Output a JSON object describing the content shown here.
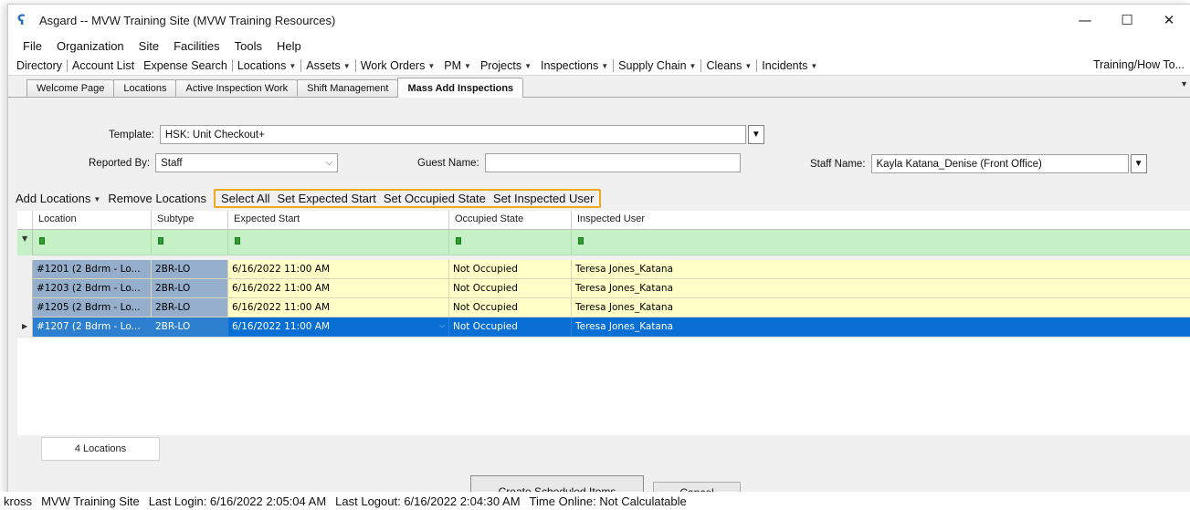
{
  "window": {
    "title": "Asgard -- MVW Training Site (MVW Training Resources)",
    "icon": "asgard-logo-icon",
    "controls": {
      "minimize": "—",
      "maximize": "☐",
      "close": "✕"
    }
  },
  "menu": [
    "File",
    "Organization",
    "Site",
    "Facilities",
    "Tools",
    "Help"
  ],
  "nav": {
    "items": [
      {
        "label": "Directory",
        "dropdown": false
      },
      {
        "label": "Account List",
        "dropdown": false
      },
      {
        "label": "Expense Search",
        "dropdown": false
      },
      {
        "label": "Locations",
        "dropdown": true
      },
      {
        "label": "Assets",
        "dropdown": true
      },
      {
        "label": "Work Orders",
        "dropdown": true
      },
      {
        "label": "PM",
        "dropdown": true
      },
      {
        "label": "Projects",
        "dropdown": true
      },
      {
        "label": "Inspections",
        "dropdown": true
      },
      {
        "label": "Supply Chain",
        "dropdown": true
      },
      {
        "label": "Cleans",
        "dropdown": true
      },
      {
        "label": "Incidents",
        "dropdown": true
      }
    ],
    "right": "Training/How To..."
  },
  "tabs": [
    "Welcome Page",
    "Locations",
    "Active Inspection Work",
    "Shift Management",
    "Mass Add Inspections"
  ],
  "active_tab": 4,
  "form": {
    "template_label": "Template:",
    "template_value": "HSK: Unit Checkout+",
    "reported_by_label": "Reported By:",
    "reported_by_value": "Staff",
    "guest_name_label": "Guest Name:",
    "guest_name_value": "",
    "staff_name_label": "Staff Name:",
    "staff_name_value": "Kayla Katana_Denise (Front Office)"
  },
  "actions": {
    "add_locations": "Add Locations",
    "remove_locations": "Remove Locations",
    "highlighted": [
      "Select All",
      "Set Expected Start",
      "Set Occupied State",
      "Set Inspected User"
    ],
    "highlight_color": "#f2a81d"
  },
  "grid": {
    "columns": [
      "Location",
      "Subtype",
      "Expected Start",
      "Occupied State",
      "Inspected User"
    ],
    "rows": [
      {
        "location": "#1201 (2 Bdrm - Lo...",
        "subtype": "2BR-LO",
        "expected_start": "6/16/2022 11:00 AM",
        "occupied": "Not Occupied",
        "user": "Teresa Jones_Katana",
        "selected": false
      },
      {
        "location": "#1203 (2 Bdrm - Lo...",
        "subtype": "2BR-LO",
        "expected_start": "6/16/2022 11:00 AM",
        "occupied": "Not Occupied",
        "user": "Teresa Jones_Katana",
        "selected": false
      },
      {
        "location": "#1205 (2 Bdrm - Lo...",
        "subtype": "2BR-LO",
        "expected_start": "6/16/2022 11:00 AM",
        "occupied": "Not Occupied",
        "user": "Teresa Jones_Katana",
        "selected": false
      },
      {
        "location": "#1207 (2 Bdrm - Lo...",
        "subtype": "2BR-LO",
        "expected_start": "6/16/2022 11:00 AM",
        "occupied": "Not Occupied",
        "user": "Teresa Jones_Katana",
        "selected": true
      }
    ],
    "count_label": "4 Locations",
    "colors": {
      "row_bg": "#ffffc8",
      "key_col_bg": "#94aecb",
      "selected_bg": "#0a6fd4",
      "filter_bg": "#c6f0c6"
    }
  },
  "buttons": {
    "create": "Create Scheduled Items",
    "cancel": "Cancel"
  },
  "status": {
    "user": "kross",
    "site": "MVW Training Site",
    "last_login": "Last Login: 6/16/2022 2:05:04 AM",
    "last_logout": "Last Logout: 6/16/2022 2:04:30 AM",
    "time_online": "Time Online: Not Calculatable"
  }
}
